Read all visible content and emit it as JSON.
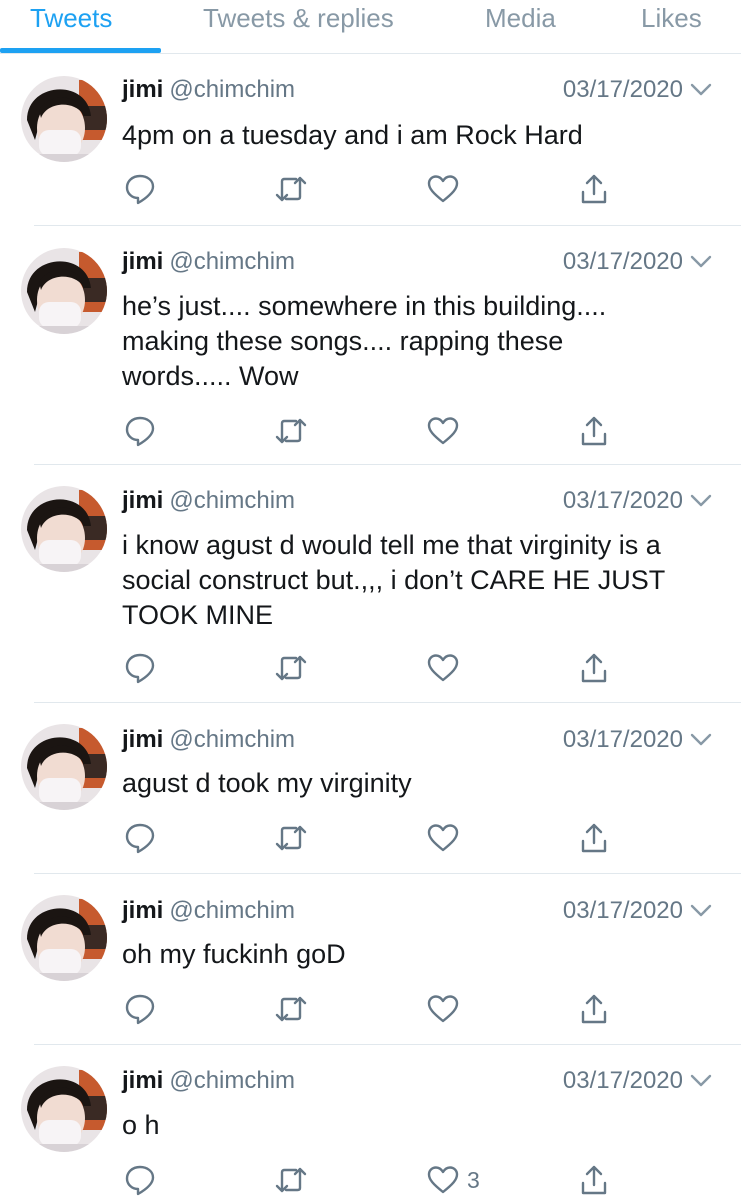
{
  "tabs": [
    {
      "label": "Tweets",
      "active": true
    },
    {
      "label": "Tweets & replies",
      "active": false
    },
    {
      "label": "Media",
      "active": false
    },
    {
      "label": "Likes",
      "active": false
    }
  ],
  "colors": {
    "accent": "#1da1f2",
    "text": "#14171a",
    "muted": "#657786",
    "border": "#e1e8ed"
  },
  "icons": {
    "reply": "reply-icon",
    "retweet": "retweet-icon",
    "like": "heart-icon",
    "share": "share-icon",
    "menu": "chevron-down-icon"
  },
  "tweets": [
    {
      "name": "jimi",
      "handle": "@chimchim",
      "date": "03/17/2020",
      "text": "4pm on a tuesday and i am Rock Hard",
      "likes": ""
    },
    {
      "name": "jimi",
      "handle": "@chimchim",
      "date": "03/17/2020",
      "text": "he’s just.... somewhere in this building....\nmaking these songs.... rapping these\nwords..... Wow",
      "likes": ""
    },
    {
      "name": "jimi",
      "handle": "@chimchim",
      "date": "03/17/2020",
      "text": "i know agust d would tell me that virginity is a\nsocial construct but.,,, i don’t CARE HE JUST\nTOOK MINE",
      "likes": ""
    },
    {
      "name": "jimi",
      "handle": "@chimchim",
      "date": "03/17/2020",
      "text": "agust d took my virginity",
      "likes": ""
    },
    {
      "name": "jimi",
      "handle": "@chimchim",
      "date": "03/17/2020",
      "text": "oh my fuckinh goD",
      "likes": ""
    },
    {
      "name": "jimi",
      "handle": "@chimchim",
      "date": "03/17/2020",
      "text": "o h",
      "likes": "3"
    }
  ]
}
